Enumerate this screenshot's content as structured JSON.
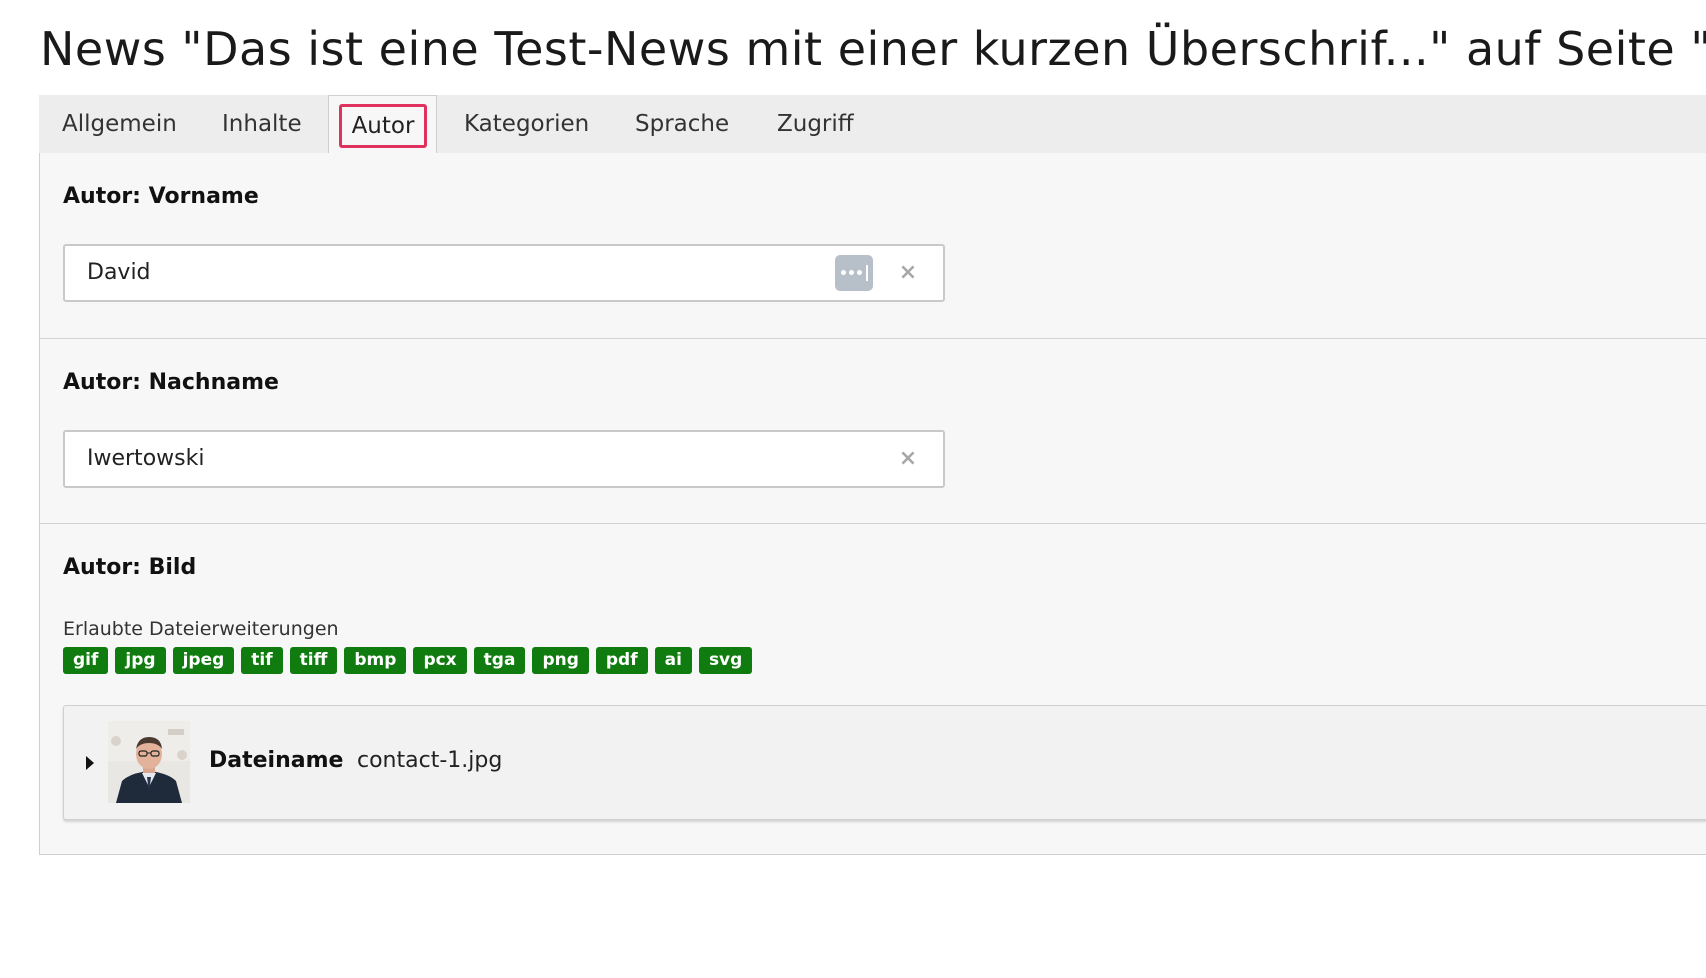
{
  "page": {
    "title": "News \"Das ist eine Test-News mit einer kurzen Überschrif...\" auf Seite \"N"
  },
  "tabs": [
    {
      "label": "Allgemein",
      "active": false
    },
    {
      "label": "Inhalte",
      "active": false
    },
    {
      "label": "Autor",
      "active": true
    },
    {
      "label": "Kategorien",
      "active": false
    },
    {
      "label": "Sprache",
      "active": false
    },
    {
      "label": "Zugriff",
      "active": false
    }
  ],
  "fields": {
    "firstname": {
      "label": "Autor: Vorname",
      "value": "David",
      "icons": [
        "password-manager-icon",
        "clear-icon"
      ]
    },
    "lastname": {
      "label": "Autor: Nachname",
      "value": "Iwertowski",
      "icons": [
        "clear-icon"
      ]
    },
    "image": {
      "label": "Autor: Bild",
      "allowed_caption": "Erlaubte Dateierweiterungen",
      "extensions": [
        "gif",
        "jpg",
        "jpeg",
        "tif",
        "tiff",
        "bmp",
        "pcx",
        "tga",
        "png",
        "pdf",
        "ai",
        "svg"
      ],
      "file": {
        "key_label": "Dateiname",
        "filename": "contact-1.jpg"
      }
    }
  },
  "colors": {
    "accent_focus": "#e0325f",
    "badge_green": "#107c10",
    "panel_bg": "#f7f7f7",
    "tabbar_bg": "#ededed"
  }
}
